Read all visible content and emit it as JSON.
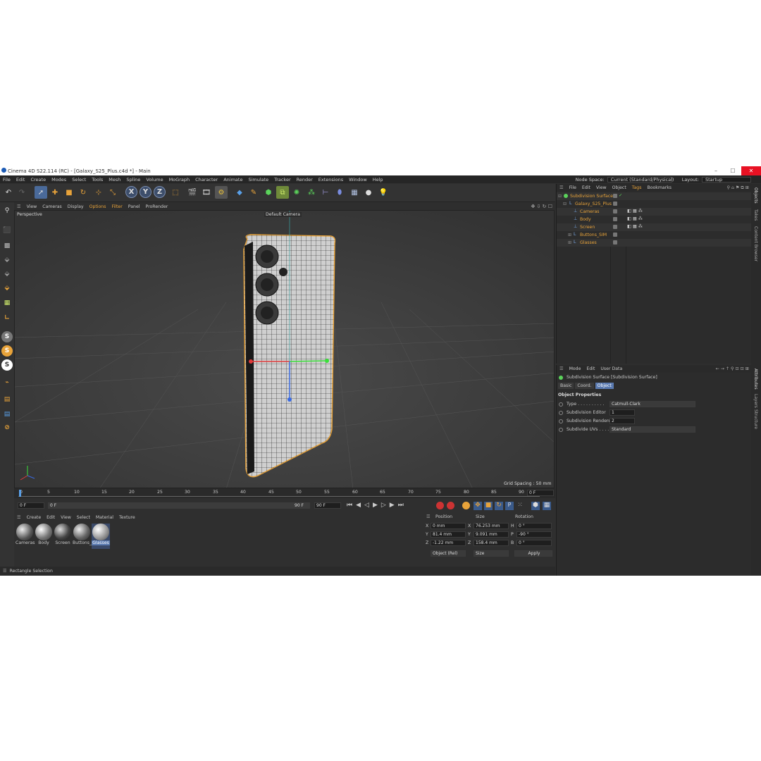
{
  "window": {
    "title": "Cinema 4D S22.114 (RC) - [Galaxy_S25_Plus.c4d *] - Main"
  },
  "menu": {
    "items": [
      "File",
      "Edit",
      "Create",
      "Modes",
      "Select",
      "Tools",
      "Mesh",
      "Spline",
      "Volume",
      "MoGraph",
      "Character",
      "Animate",
      "Simulate",
      "Tracker",
      "Render",
      "Extensions",
      "Window",
      "Help"
    ],
    "node_space_label": "Node Space:",
    "node_space_value": "Current (Standard/Physical)",
    "layout_label": "Layout:",
    "layout_value": "Startup"
  },
  "viewport": {
    "menu": [
      "View",
      "Cameras",
      "Display",
      "Options",
      "Filter",
      "Panel",
      "ProRender"
    ],
    "view_name": "Perspective",
    "camera_label": "Default Camera",
    "grid_spacing": "Grid Spacing : 50 mm"
  },
  "timeline": {
    "ticks": [
      "0",
      "5",
      "10",
      "15",
      "20",
      "25",
      "30",
      "35",
      "40",
      "45",
      "50",
      "55",
      "60",
      "65",
      "70",
      "75",
      "80",
      "85",
      "90"
    ],
    "current_frame_right": "0 F"
  },
  "transport": {
    "start_field": "0 F",
    "range_start": "0 F",
    "range_end": "90 F",
    "end_field": "90 F"
  },
  "materials": {
    "menu": [
      "Create",
      "Edit",
      "View",
      "Select",
      "Material",
      "Texture"
    ],
    "items": [
      {
        "label": "Cameras"
      },
      {
        "label": "Body"
      },
      {
        "label": "Screen"
      },
      {
        "label": "Buttons_"
      },
      {
        "label": "Glasses"
      }
    ]
  },
  "coords": {
    "headers": {
      "position": "Position",
      "size": "Size",
      "rotation": "Rotation"
    },
    "rows": [
      {
        "axis": "X",
        "pos": "0 mm",
        "size_axis": "X",
        "size": "76.253 mm",
        "rot_axis": "H",
        "rot": "0 °"
      },
      {
        "axis": "Y",
        "pos": "81.4 mm",
        "size_axis": "Y",
        "size": "9.091 mm",
        "rot_axis": "P",
        "rot": "-90 °"
      },
      {
        "axis": "Z",
        "pos": "-1.22 mm",
        "size_axis": "Z",
        "size": "158.4 mm",
        "rot_axis": "B",
        "rot": "0 °"
      }
    ],
    "mode_select": "Object (Rel)",
    "size_select": "Size",
    "apply_label": "Apply"
  },
  "status": {
    "text": "Rectangle Selection"
  },
  "object_manager": {
    "menu": [
      "File",
      "Edit",
      "View",
      "Object",
      "Tags",
      "Bookmarks"
    ],
    "objects": [
      {
        "name": "Subdivision Surface",
        "level": 0
      },
      {
        "name": "Galaxy_S25_Plus",
        "level": 1
      },
      {
        "name": "Cameras",
        "level": 2
      },
      {
        "name": "Body",
        "level": 2
      },
      {
        "name": "Screen",
        "level": 2
      },
      {
        "name": "Buttons_SIM",
        "level": 2
      },
      {
        "name": "Glasses",
        "level": 2
      }
    ]
  },
  "attributes": {
    "menu": [
      "Mode",
      "Edit",
      "User Data"
    ],
    "object_title": "Subdivision Surface [Subdivision Surface]",
    "tabs": [
      "Basic",
      "Coord.",
      "Object"
    ],
    "section": "Object Properties",
    "props": [
      {
        "label": "Type . . . . . . . . . .",
        "value": "Catmull-Clark"
      },
      {
        "label": "Subdivision Editor",
        "value": "1"
      },
      {
        "label": "Subdivision Renderer",
        "value": "2"
      },
      {
        "label": "Subdivide UVs . . . .",
        "value": "Standard"
      }
    ]
  },
  "side_tabs": {
    "top": [
      "Objects",
      "Takes",
      "Content Browser"
    ],
    "bottom": [
      "Attributes",
      "Layers",
      "Structure"
    ]
  }
}
